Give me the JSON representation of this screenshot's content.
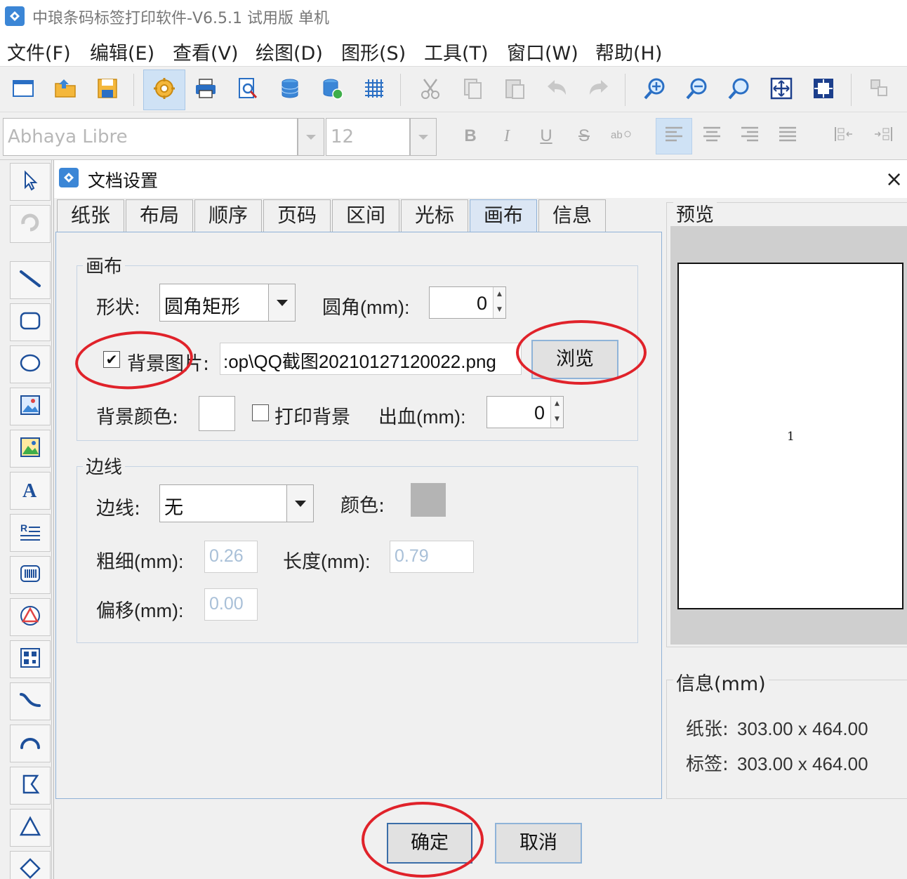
{
  "window": {
    "title": "中琅条码标签打印软件-V6.5.1 试用版 单机"
  },
  "menu": [
    {
      "label": "文件(F)"
    },
    {
      "label": "编辑(E)"
    },
    {
      "label": "查看(V)"
    },
    {
      "label": "绘图(D)"
    },
    {
      "label": "图形(S)"
    },
    {
      "label": "工具(T)"
    },
    {
      "label": "窗口(W)"
    },
    {
      "label": "帮助(H)"
    }
  ],
  "toolbar": {
    "icons": [
      "new-document-icon",
      "open-folder-icon",
      "save-icon",
      "settings-icon",
      "print-icon",
      "print-preview-icon",
      "database-icon",
      "database-connect-icon",
      "grid-icon",
      "cut-icon",
      "copy-icon",
      "paste-icon",
      "undo-icon",
      "redo-icon",
      "zoom-in-icon",
      "zoom-out-icon",
      "zoom-fit-icon",
      "fit-page-icon",
      "actual-size-icon",
      "arrange-icon"
    ],
    "active_icon": "settings-icon"
  },
  "fontbar": {
    "font_name": "Abhaya Libre",
    "font_size": "12",
    "bold": "B",
    "italic": "I",
    "underline": "U",
    "strike": "S"
  },
  "dialog": {
    "title": "文档设置",
    "close_glyph": "×",
    "tabs": [
      {
        "label": "纸张"
      },
      {
        "label": "布局"
      },
      {
        "label": "顺序"
      },
      {
        "label": "页码"
      },
      {
        "label": "区间"
      },
      {
        "label": "光标"
      },
      {
        "label": "画布"
      },
      {
        "label": "信息"
      }
    ],
    "active_tab": "画布",
    "canvas_group": {
      "legend": "画布",
      "shape_label": "形状:",
      "shape_value": "圆角矩形",
      "corner_label": "圆角(mm):",
      "corner_value": "0",
      "bg_image_label": "背景图片:",
      "bg_image_checked": true,
      "bg_image_path": ":op\\QQ截图20210127120022.png",
      "browse_label": "浏览",
      "bg_color_label": "背景颜色:",
      "bg_color": "#ffffff",
      "print_bg_label": "打印背景",
      "print_bg_checked": false,
      "bleed_label": "出血(mm):",
      "bleed_value": "0"
    },
    "border_group": {
      "legend": "边线",
      "border_label": "边线:",
      "border_value": "无",
      "color_label": "颜色:",
      "color_value": "#b4b4b4",
      "thickness_label": "粗细(mm):",
      "thickness_value": "0.26",
      "length_label": "长度(mm):",
      "length_value": "0.79",
      "offset_label": "偏移(mm):",
      "offset_value": "0.00"
    },
    "preview": {
      "legend": "预览",
      "page_number": "1"
    },
    "info": {
      "legend": "信息(mm)",
      "paper_label": "纸张:",
      "paper_value": "303.00 x 464.00",
      "label_label": "标签:",
      "label_value": "303.00 x 464.00"
    },
    "ok_label": "确定",
    "cancel_label": "取消"
  },
  "colors": {
    "accent": "#3b86d6",
    "annotation": "#e0222a",
    "active_tab": "#dbe6f4"
  }
}
